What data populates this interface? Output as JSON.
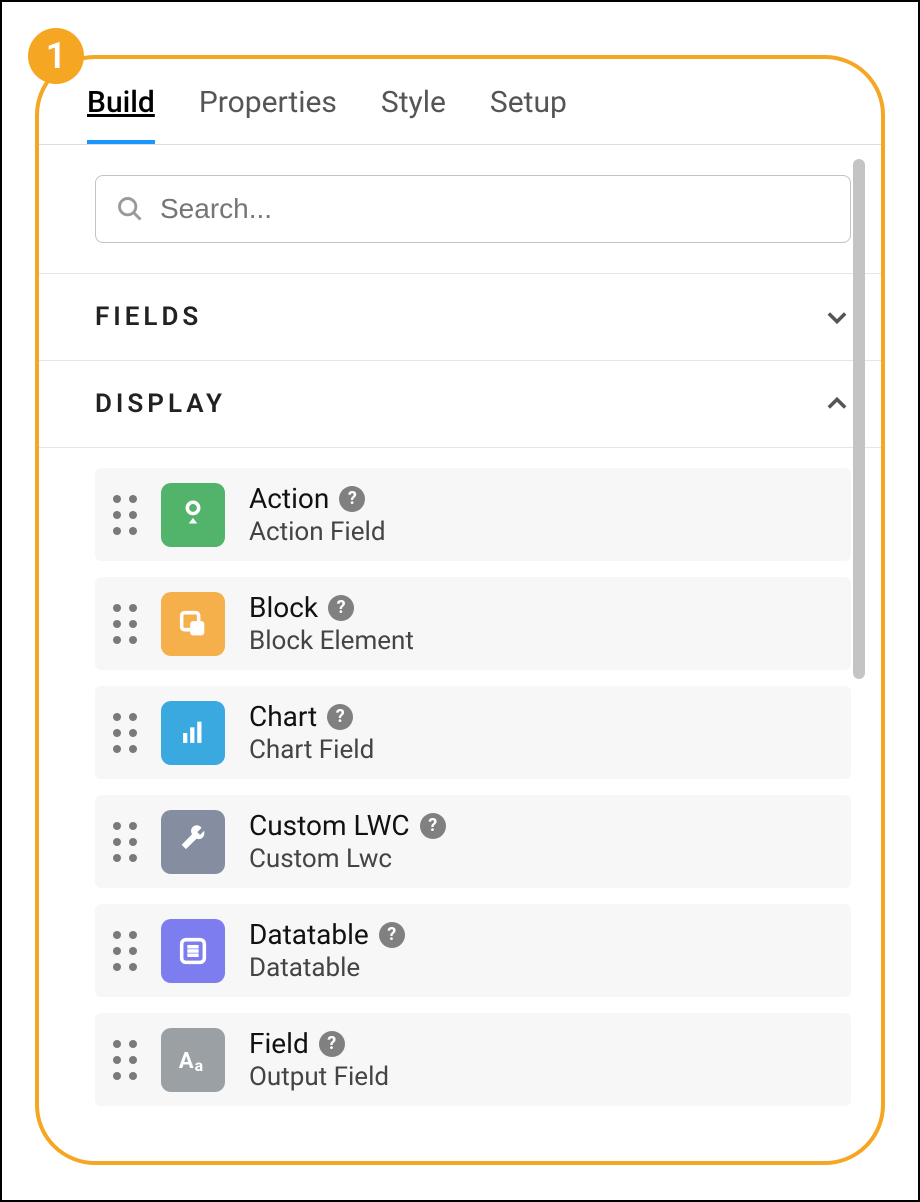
{
  "callout": {
    "number": "1"
  },
  "tabs": {
    "items": [
      {
        "label": "Build",
        "active": true
      },
      {
        "label": "Properties",
        "active": false
      },
      {
        "label": "Style",
        "active": false
      },
      {
        "label": "Setup",
        "active": false
      }
    ]
  },
  "search": {
    "placeholder": "Search..."
  },
  "sections": {
    "fields": {
      "title": "FIELDS",
      "expanded": false
    },
    "display": {
      "title": "DISPLAY",
      "expanded": true,
      "items": [
        {
          "title": "Action",
          "subtitle": "Action Field",
          "icon": "action"
        },
        {
          "title": "Block",
          "subtitle": "Block Element",
          "icon": "block"
        },
        {
          "title": "Chart",
          "subtitle": "Chart Field",
          "icon": "chart"
        },
        {
          "title": "Custom LWC",
          "subtitle": "Custom Lwc",
          "icon": "lwc"
        },
        {
          "title": "Datatable",
          "subtitle": "Datatable",
          "icon": "data"
        },
        {
          "title": "Field",
          "subtitle": "Output Field",
          "icon": "field"
        }
      ]
    }
  }
}
